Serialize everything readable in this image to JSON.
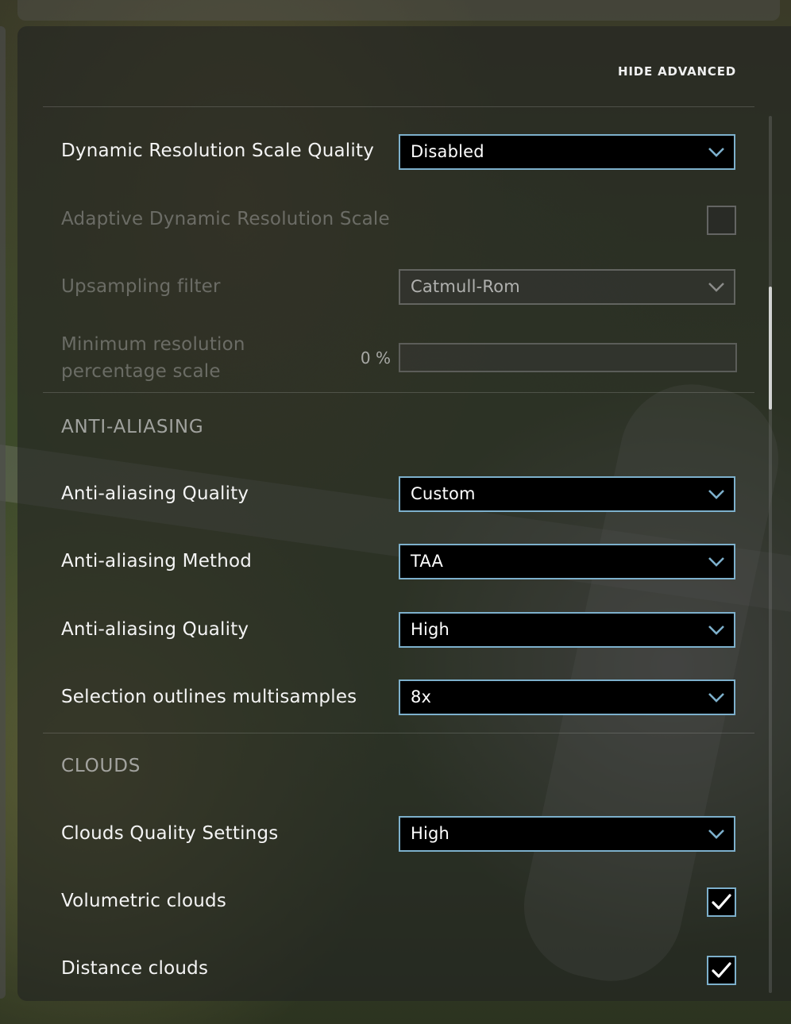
{
  "header": {
    "toggle_advanced_label": "HIDE ADVANCED"
  },
  "rows": {
    "dynamic_res_quality": {
      "label": "Dynamic Resolution Scale Quality",
      "value": "Disabled"
    },
    "adaptive_dynamic_res": {
      "label": "Adaptive Dynamic Resolution Scale",
      "checked": false,
      "enabled": false
    },
    "upsampling_filter": {
      "label": "Upsampling filter",
      "value": "Catmull-Rom",
      "enabled": false
    },
    "min_res_percentage": {
      "label": "Minimum resolution percentage scale",
      "value_text": "0 %",
      "value": 0,
      "enabled": false
    }
  },
  "sections": {
    "anti_aliasing": {
      "title": "ANTI-ALIASING",
      "rows": [
        {
          "label": "Anti-aliasing Quality",
          "value": "Custom"
        },
        {
          "label": "Anti-aliasing Method",
          "value": "TAA"
        },
        {
          "label": "Anti-aliasing Quality",
          "value": "High"
        },
        {
          "label": "Selection outlines multisamples",
          "value": "8x"
        }
      ]
    },
    "clouds": {
      "title": "CLOUDS",
      "quality": {
        "label": "Clouds Quality Settings",
        "value": "High"
      },
      "volumetric": {
        "label": "Volumetric clouds",
        "checked": true
      },
      "distance": {
        "label": "Distance clouds",
        "checked": true
      }
    }
  },
  "icons": {
    "dropdown": "chevron-down-icon",
    "check": "checkmark-icon"
  },
  "colors": {
    "accent_border": "#7db0cc",
    "panel_bg": "#222422",
    "text": "#f4f4f4"
  }
}
